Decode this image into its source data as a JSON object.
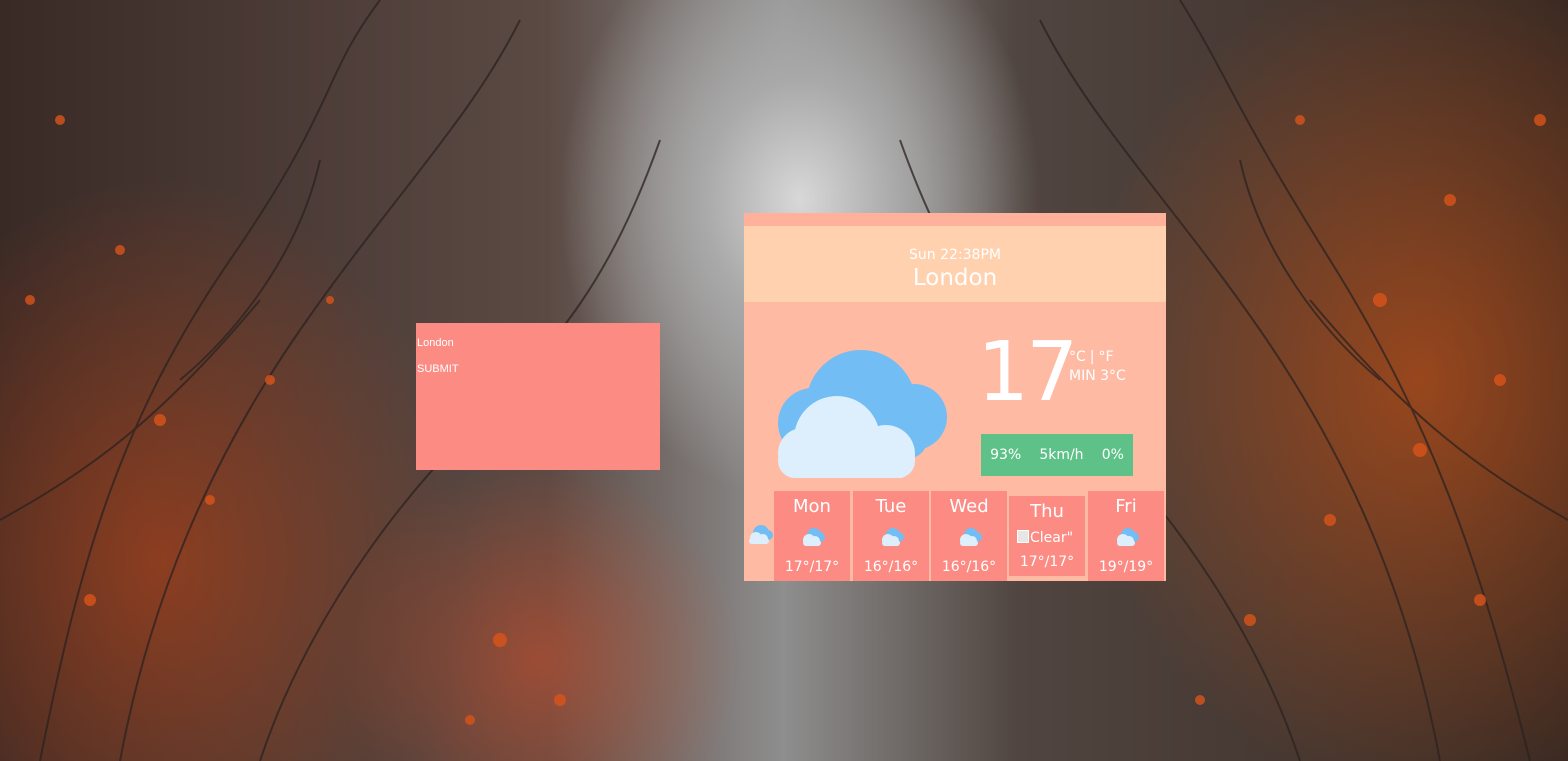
{
  "search": {
    "input_value": "London",
    "submit_label": "SUBMIT"
  },
  "weather": {
    "datetime": "Sun 22:38PM",
    "city": "London",
    "temperature": "17",
    "unit_c": "°C",
    "unit_sep": "|",
    "unit_f": "°F",
    "min_temp": "MIN 3°C",
    "humidity": "93%",
    "wind": "5km/h",
    "precipitation": "0%",
    "main_icon": "cloud-icon"
  },
  "forecast": [
    {
      "day": "Mon",
      "range": "17°/17°",
      "icon": "cloud-icon"
    },
    {
      "day": "Tue",
      "range": "16°/16°",
      "icon": "cloud-icon"
    },
    {
      "day": "Wed",
      "range": "16°/16°",
      "icon": "cloud-icon"
    },
    {
      "day": "Thu",
      "range": "17°/17°",
      "icon": "broken-image-icon",
      "alt": "Clear\""
    },
    {
      "day": "Fri",
      "range": "19°/19°",
      "icon": "cloud-icon"
    }
  ],
  "colors": {
    "panel": "#fc8b84",
    "card": "#ffbaa3",
    "header": "#ffd1ae",
    "stats": "#5ec187",
    "cloud_back": "#72bdf4",
    "cloud_front": "#ddeefc"
  }
}
